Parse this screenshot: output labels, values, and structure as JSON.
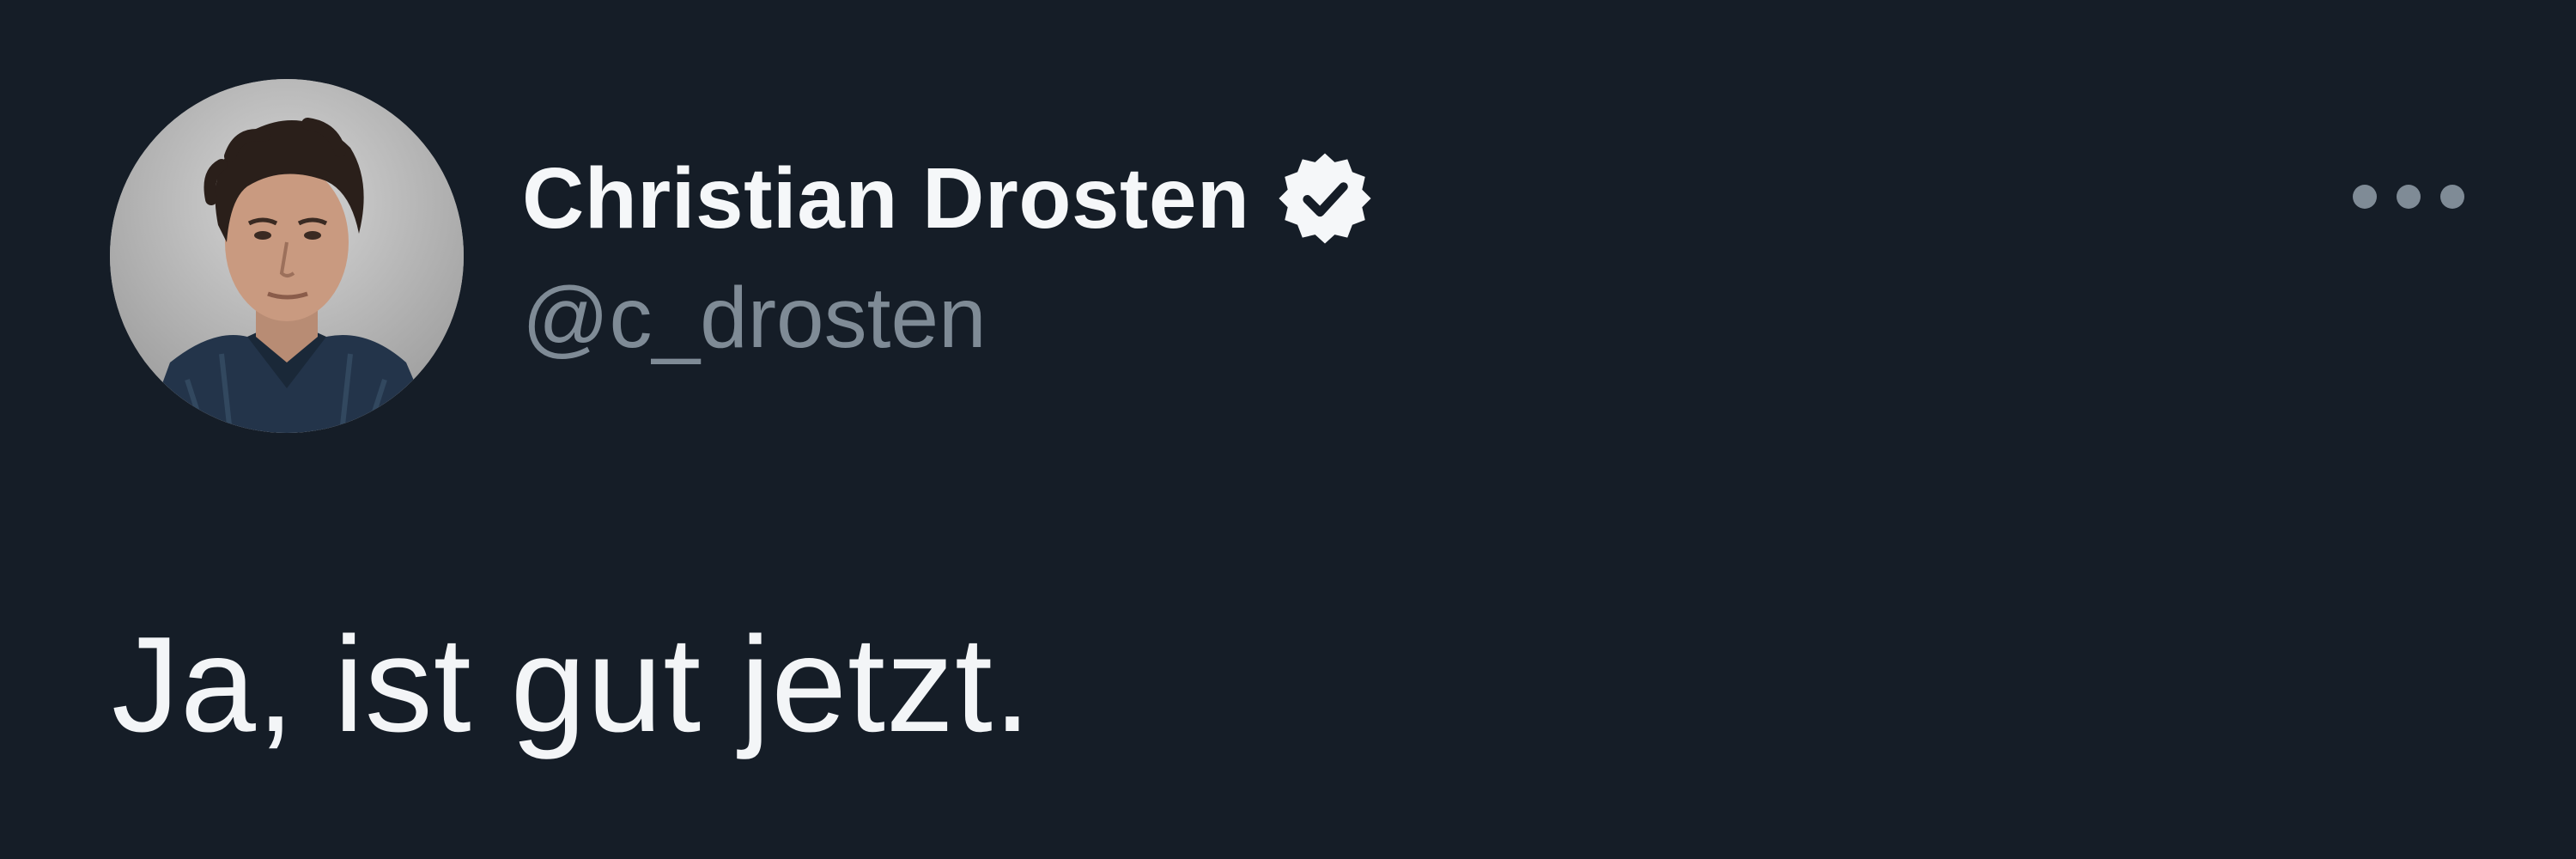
{
  "tweet": {
    "author": {
      "display_name": "Christian Drosten",
      "handle": "@c_drosten",
      "verified": true,
      "verified_icon": "verified-badge-icon",
      "avatar": "profile-photo"
    },
    "more_icon": "more-options-icon",
    "text": "Ja, ist gut jetzt."
  },
  "colors": {
    "background": "#151d27",
    "primary_text": "#f5f7f9",
    "secondary_text": "#7f8b96"
  }
}
